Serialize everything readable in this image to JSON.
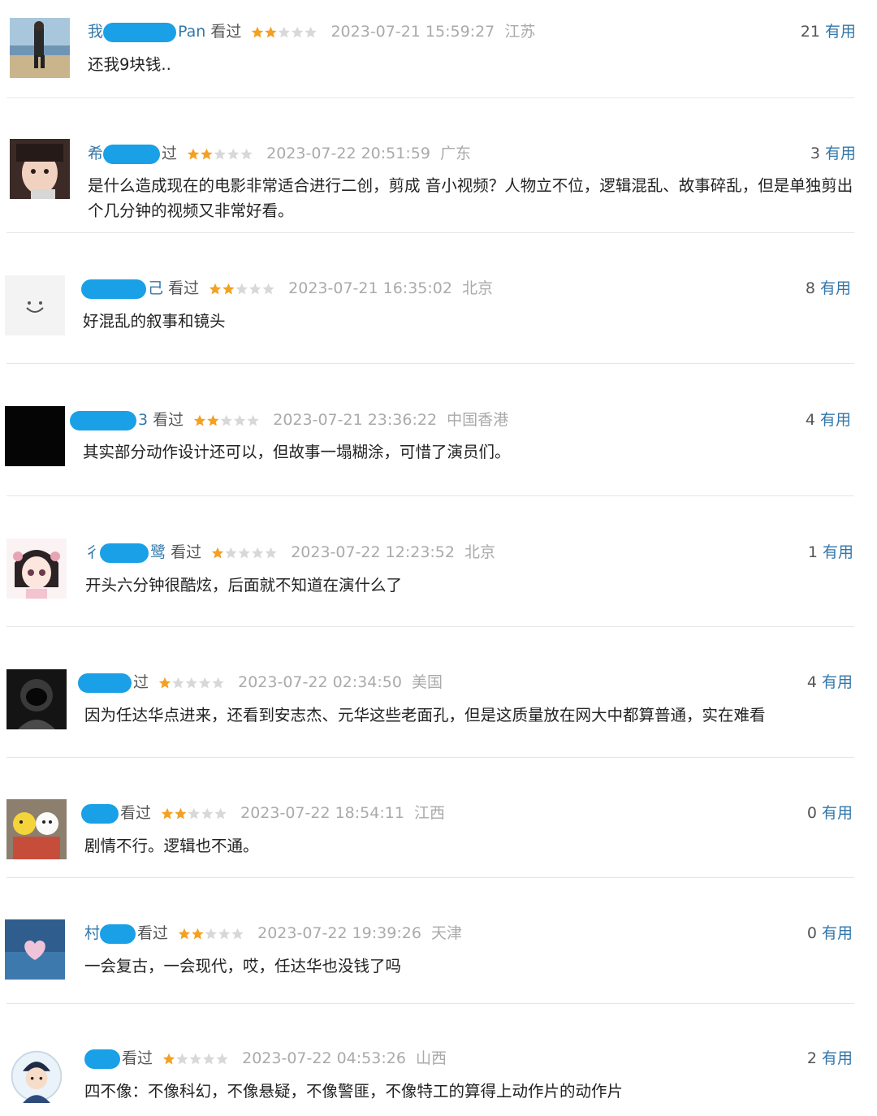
{
  "ui": {
    "useful_label": "有用",
    "watched_label": "看过"
  },
  "colors": {
    "star": "#f4a023",
    "star_empty": "#d8d8d8",
    "redaction": "#1aa0e6",
    "link": "#3377aa"
  },
  "comments": [
    {
      "name_visible": "我",
      "name_suffix": "Pan",
      "stars": 2,
      "time": "2023-07-21 15:59:27",
      "location": "江苏",
      "votes": "21",
      "text": "还我9块钱..",
      "avatar_icon": "man-on-beach-avatar"
    },
    {
      "name_visible": "希",
      "name_suffix": "",
      "watched": "过",
      "stars": 2,
      "time": "2023-07-22 20:51:59",
      "location": "广东",
      "votes": "3",
      "text": "是什么造成现在的电影非常适合进行二创，剪成 音小视频？人物立不位，逻辑混乱、故事碎乱，但是单独剪出个几分钟的视频又非常好看。",
      "avatar_icon": "child-face-avatar"
    },
    {
      "name_visible": "",
      "name_suffix": "己",
      "stars": 2,
      "time": "2023-07-21 16:35:02",
      "location": "北京",
      "votes": "8",
      "text": "好混乱的叙事和镜头",
      "avatar_icon": "smiley-avatar"
    },
    {
      "name_visible": "",
      "name_suffix": "3",
      "stars": 2,
      "time": "2023-07-21 23:36:22",
      "location": "中国香港",
      "votes": "4",
      "text": "其实部分动作设计还可以，但故事一塌糊涂，可惜了演员们。",
      "avatar_icon": "black-avatar"
    },
    {
      "name_visible": "彳",
      "name_suffix": "鹭",
      "stars": 1,
      "time": "2023-07-22 12:23:52",
      "location": "北京",
      "votes": "1",
      "text": "开头六分钟很酷炫，后面就不知道在演什么了",
      "avatar_icon": "anime-girl-avatar"
    },
    {
      "name_visible": "",
      "name_suffix": "",
      "watched": "过",
      "stars": 1,
      "time": "2023-07-22 02:34:50",
      "location": "美国",
      "votes": "4",
      "text": "因为任达华点进来，还看到安志杰、元华这些老面孔，但是这质量放在网大中都算普通，实在难看",
      "avatar_icon": "astronaut-avatar"
    },
    {
      "name_visible": "",
      "name_suffix": "",
      "stars": 2,
      "time": "2023-07-22 18:54:11",
      "location": "江西",
      "votes": "0",
      "text": "剧情不行。逻辑也不通。",
      "avatar_icon": "toys-avatar"
    },
    {
      "name_visible": "村",
      "name_suffix": "",
      "stars": 2,
      "time": "2023-07-22 19:39:26",
      "location": "天津",
      "votes": "0",
      "text": "一会复古，一会现代，哎，任达华也没钱了吗",
      "avatar_icon": "heart-cloud-avatar"
    },
    {
      "name_visible": "",
      "name_suffix": "",
      "stars": 1,
      "time": "2023-07-22 04:53:26",
      "location": "山西",
      "votes": "2",
      "text": "四不像：不像科幻，不像悬疑，不像警匪，不像特工的算得上动作片的动作片",
      "avatar_icon": "police-cartoon-avatar"
    }
  ]
}
